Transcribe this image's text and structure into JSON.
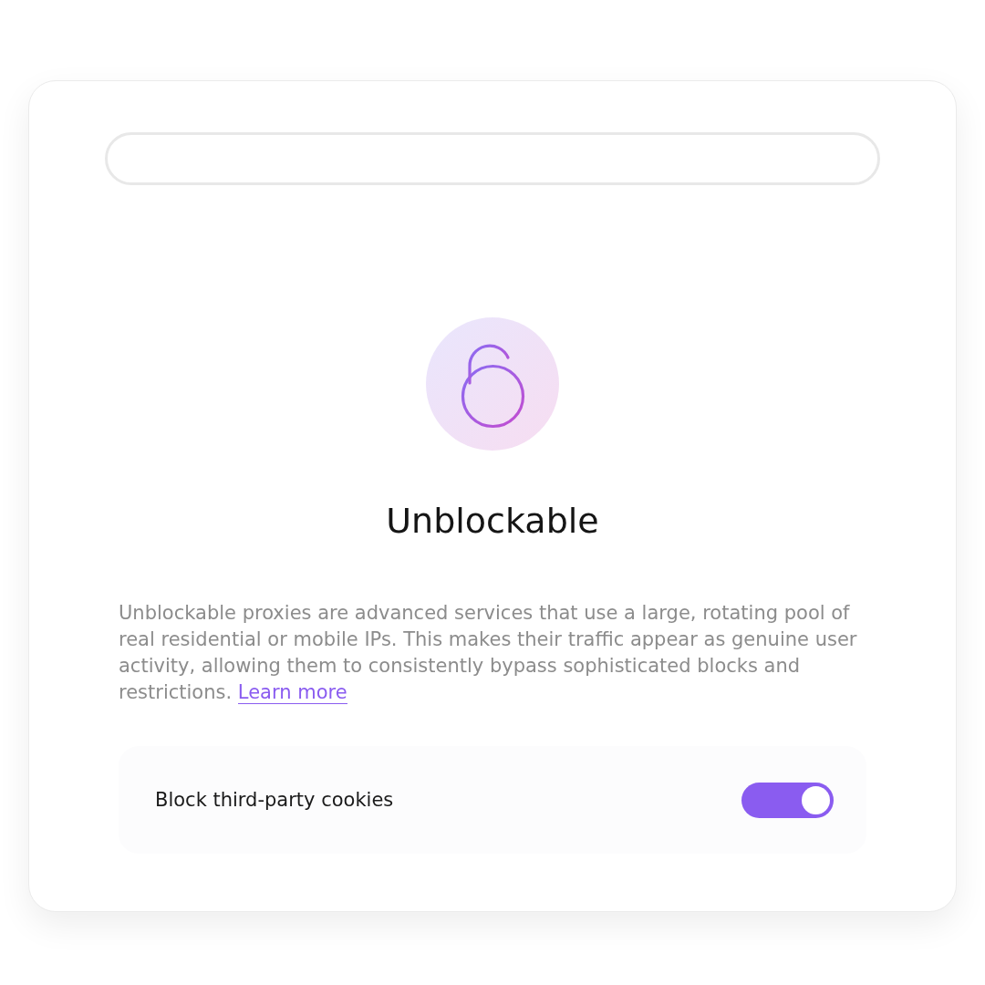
{
  "feature": {
    "title": "Unblockable",
    "description": "Unblockable proxies are advanced services that use a large, rotating pool of real residential or mobile IPs. This makes their traffic appear as genuine user activity, allowing them to consistently bypass sophisticated blocks and restrictions.",
    "link": "Learn more"
  },
  "settings": [
    {
      "kind": "toggle",
      "label": "Block third-party cookies",
      "on": true
    }
  ]
}
